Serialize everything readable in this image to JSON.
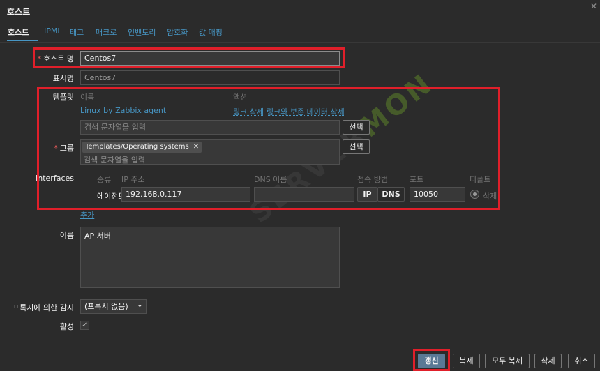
{
  "dialog": {
    "title": "호스트",
    "close_icon": "✕"
  },
  "tabs": [
    {
      "label": "호스트",
      "active": true
    },
    {
      "label": "IPMI"
    },
    {
      "label": "태그"
    },
    {
      "label": "매크로"
    },
    {
      "label": "인벤토리"
    },
    {
      "label": "암호화"
    },
    {
      "label": "값 매핑"
    }
  ],
  "form": {
    "host_name": {
      "label": "호스트 명",
      "required_mark": "*",
      "value": "Centos7"
    },
    "visible_name": {
      "label": "표시명",
      "placeholder": "Centos7"
    },
    "templates": {
      "label": "템플릿",
      "col_name": "이름",
      "col_action": "액션",
      "linked": "Linux by Zabbix agent",
      "unlink": "링크 삭제",
      "unlink_clear": "링크와 보존 데이터 삭제",
      "search_placeholder": "검색 문자열을 입력",
      "select_button": "선택"
    },
    "groups": {
      "label": "그룹",
      "required_mark": "*",
      "chip": "Templates/Operating systems",
      "chip_remove": "✕",
      "search_placeholder": "검색 문자열을 입력",
      "select_button": "선택"
    },
    "interfaces": {
      "label": "Interfaces",
      "headers": {
        "type": "종류",
        "ip": "IP 주소",
        "dns": "DNS 이름",
        "connect": "접속 방법",
        "port": "포트",
        "default": "디폴트"
      },
      "row": {
        "type": "에이전트",
        "ip": "192.168.0.117",
        "dns": "",
        "connect_ip": "IP",
        "connect_dns": "DNS",
        "port": "10050",
        "remove": "삭제"
      },
      "add": "추가"
    },
    "description": {
      "label": "이름",
      "value": "AP 서버"
    },
    "proxy": {
      "label": "프록시에 의한 감시",
      "value": "(프록시 없음)",
      "chevron": "⌄"
    },
    "enabled": {
      "label": "활성",
      "check": "✓"
    }
  },
  "footer": {
    "update": "갱신",
    "clone": "복제",
    "full_clone": "모두 복제",
    "delete": "삭제",
    "cancel": "취소"
  },
  "watermark": {
    "text_a": "SERVER",
    "text_b": "MON"
  },
  "colors": {
    "accent": "#4796c4",
    "highlight": "#e01f2a",
    "primary_button": "#5a7995"
  }
}
